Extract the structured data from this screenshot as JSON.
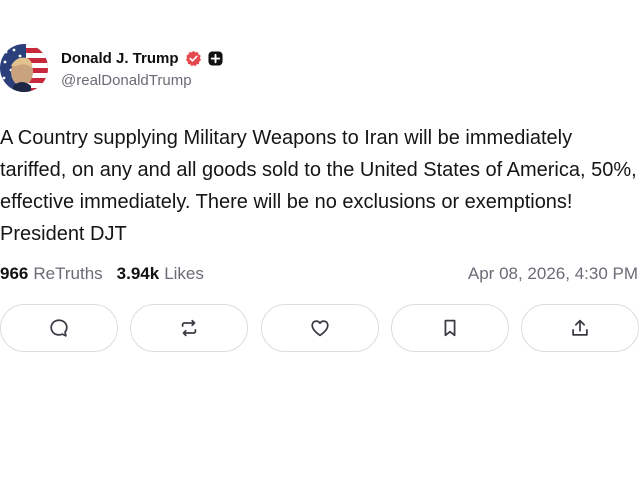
{
  "author": {
    "display_name": "Donald J. Trump",
    "handle": "@realDonaldTrump",
    "verified_icon": "verified-badge-icon",
    "plus_icon": "plus-badge-icon",
    "verified_color": "#e5484d"
  },
  "post": {
    "text": "A Country supplying Military Weapons to Iran will be immediately tariffed, on any and all goods sold to the United States of America, 50%, effective immediately. There will be no exclusions or exemptions! President DJT"
  },
  "stats": {
    "retruths_count": "966",
    "retruths_label": "ReTruths",
    "likes_count": "3.94k",
    "likes_label": "Likes",
    "timestamp": "Apr 08, 2026, 4:30 PM"
  },
  "actions": [
    {
      "icon": "reply-icon"
    },
    {
      "icon": "retruth-icon"
    },
    {
      "icon": "heart-icon"
    },
    {
      "icon": "bookmark-icon"
    },
    {
      "icon": "share-icon"
    }
  ]
}
